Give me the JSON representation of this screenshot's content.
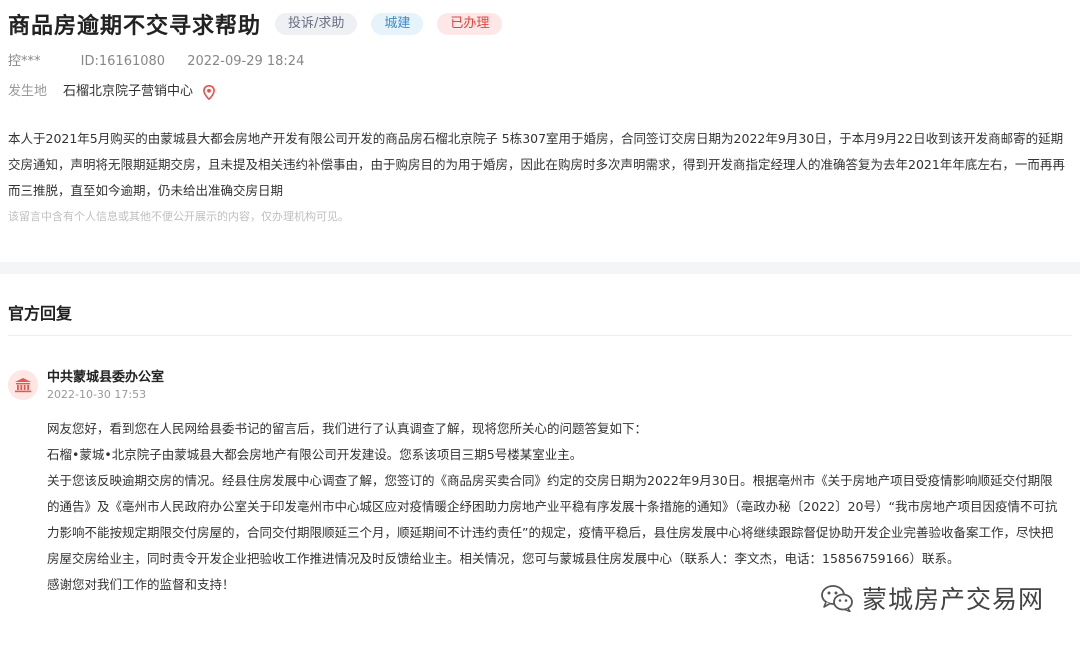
{
  "header": {
    "title": "商品房逾期不交寻求帮助",
    "tags": [
      "投诉/求助",
      "城建",
      "已办理"
    ],
    "author": "控***",
    "id": "ID:16161080",
    "datetime": "2022-09-29 18:24",
    "location_label": "发生地",
    "location_value": "石榴北京院子营销中心"
  },
  "message": {
    "body": "本人于2021年5月购买的由蒙城县大都会房地产开发有限公司开发的商品房石榴北京院子 5栋307室用于婚房，合同签订交房日期为2022年9月30日，于本月9月22日收到该开发商邮寄的延期交房通知，声明将无限期延期交房，且未提及相关违约补偿事由，由于购房目的为用于婚房，因此在购房时多次声明需求，得到开发商指定经理人的准确答复为去年2021年年底左右，一而再再而三推脱，直至如今逾期，仍未给出准确交房日期",
    "privacy_notice": "该留言中含有个人信息或其他不便公开展示的内容，仅办理机构可见。"
  },
  "official_reply": {
    "section_title": "官方回复",
    "org_name": "中共蒙城县委办公室",
    "datetime": "2022-10-30 17:53",
    "paragraphs": [
      "网友您好，看到您在人民网给县委书记的留言后，我们进行了认真调查了解，现将您所关心的问题答复如下：",
      "石榴•蒙城•北京院子由蒙城县大都会房地产有限公司开发建设。您系该项目三期5号楼某室业主。",
      "关于您该反映逾期交房的情况。经县住房发展中心调查了解，您签订的《商品房买卖合同》约定的交房日期为2022年9月30日。根据亳州市《关于房地产项目受疫情影响顺延交付期限的通告》及《亳州市人民政府办公室关于印发亳州市中心城区应对疫情暖企纾困助力房地产业平稳有序发展十条措施的通知》（亳政办秘〔2022〕20号）“我市房地产项目因疫情不可抗力影响不能按规定期限交付房屋的，合同交付期限顺延三个月，顺延期间不计违约责任”的规定，疫情平稳后，县住房发展中心将继续跟踪督促协助开发企业完善验收备案工作，尽快把房屋交房给业主，同时责令开发企业把验收工作推进情况及时反馈给业主。相关情况，您可与蒙城县住房发展中心（联系人：李文杰，电话：15856759166）联系。",
      "感谢您对我们工作的监督和支持！"
    ]
  },
  "watermark": {
    "text": "蒙城房产交易网",
    "icon": "wechat-icon"
  },
  "icons": {
    "location": "map-pin-icon",
    "org": "government-building-icon"
  },
  "colors": {
    "tag_gray_text": "#6b7080",
    "tag_blue_text": "#3b8bc9",
    "tag_red_text": "#e0443e",
    "pin": "#e8514b",
    "org_icon": "#e8574c"
  }
}
